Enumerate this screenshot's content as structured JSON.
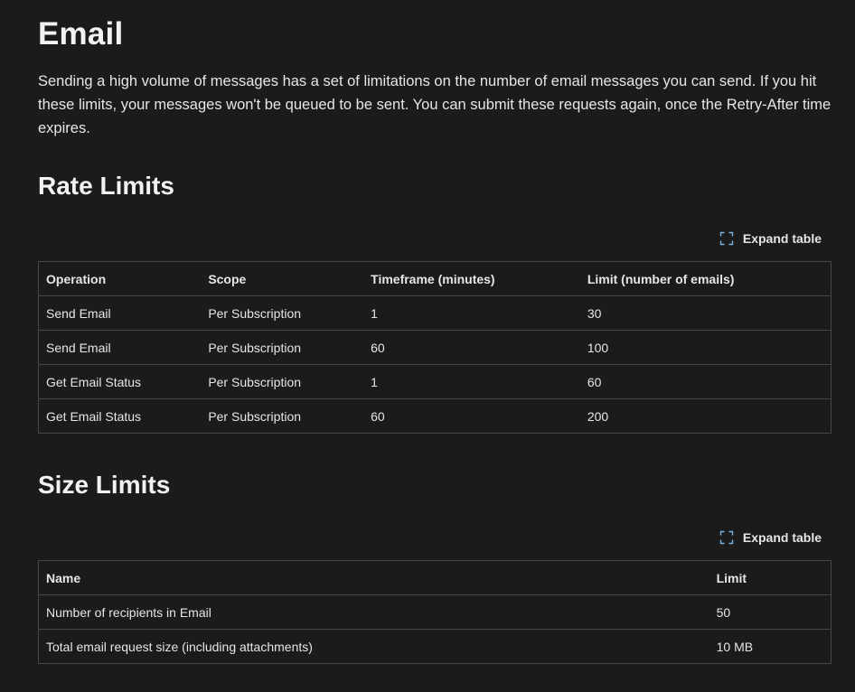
{
  "page": {
    "title": "Email",
    "intro": "Sending a high volume of messages has a set of limitations on the number of email messages you can send. If you hit these limits, your messages won't be queued to be sent. You can submit these requests again, once the Retry-After time expires."
  },
  "rate_limits": {
    "heading": "Rate Limits",
    "expand_label": "Expand table",
    "columns": [
      "Operation",
      "Scope",
      "Timeframe (minutes)",
      "Limit (number of emails)"
    ],
    "rows": [
      [
        "Send Email",
        "Per Subscription",
        "1",
        "30"
      ],
      [
        "Send Email",
        "Per Subscription",
        "60",
        "100"
      ],
      [
        "Get Email Status",
        "Per Subscription",
        "1",
        "60"
      ],
      [
        "Get Email Status",
        "Per Subscription",
        "60",
        "200"
      ]
    ]
  },
  "size_limits": {
    "heading": "Size Limits",
    "expand_label": "Expand table",
    "columns": [
      "Name",
      "Limit"
    ],
    "rows": [
      [
        "Number of recipients in Email",
        "50"
      ],
      [
        "Total email request size (including attachments)",
        "10 MB"
      ]
    ]
  },
  "colors": {
    "background": "#1b1b1b",
    "text": "#e6e6e6",
    "border": "#474747",
    "expand_icon": "#75b6e7"
  },
  "icons": {
    "expand": "fullscreen-expand-icon"
  }
}
